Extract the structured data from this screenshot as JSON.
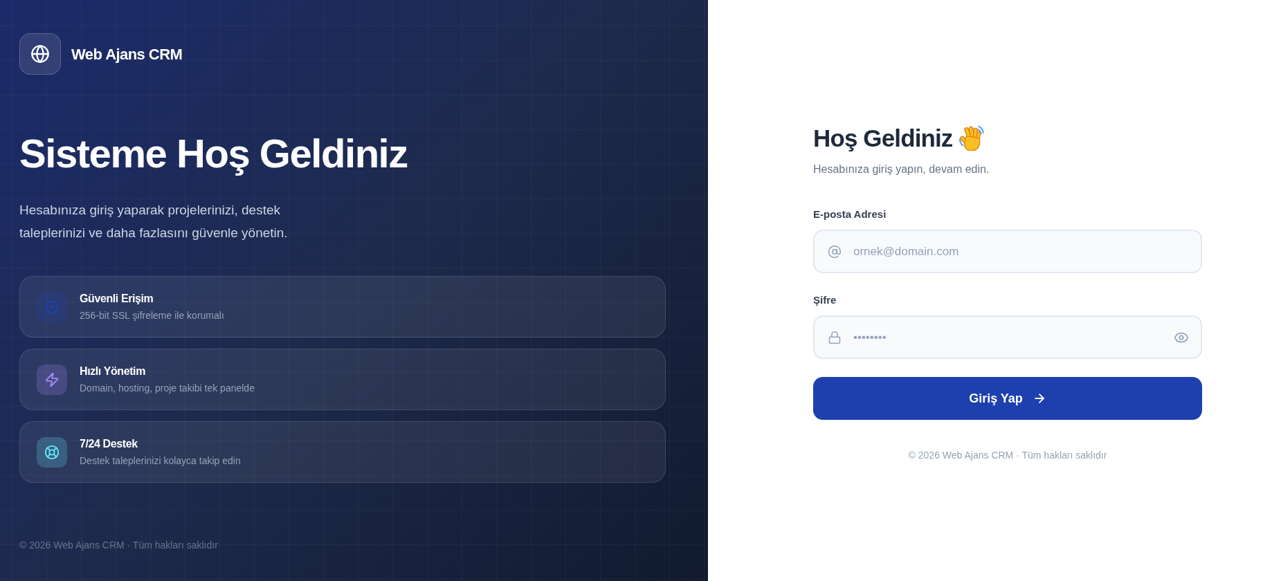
{
  "brand": {
    "name": "Web Ajans CRM"
  },
  "hero": {
    "title": "Sisteme Hoş Geldiniz",
    "description": "Hesabınıza giriş yaparak projelerinizi, destek taleplerinizi ve daha fazlasını güvenle yönetin."
  },
  "features": [
    {
      "kind": "shield",
      "title": "Güvenli Erişim",
      "description": "256-bit SSL şifreleme ile korumalı",
      "color": "#1e40af"
    },
    {
      "kind": "zap",
      "title": "Hızlı Yönetim",
      "description": "Domain, hosting, proje takibi tek panelde",
      "color": "#a78bfa"
    },
    {
      "kind": "support",
      "title": "7/24 Destek",
      "description": "Destek taleplerinizi kolayca takip edin",
      "color": "#67e8f9"
    }
  ],
  "left_footer": "© 2026 Web Ajans CRM · Tüm hakları saklıdır",
  "login": {
    "title": "Hoş Geldiniz",
    "subtitle": "Hesabınıza giriş yapın, devam edin.",
    "fields": [
      {
        "kind": "email",
        "label": "E-posta Adresi",
        "placeholder": "ornek@domain.com"
      },
      {
        "kind": "password",
        "label": "Şifre",
        "placeholder": "••••••••"
      }
    ],
    "submit": "Giriş Yap",
    "footer": "© 2026 Web Ajans CRM · Tüm hakları saklıdır"
  }
}
